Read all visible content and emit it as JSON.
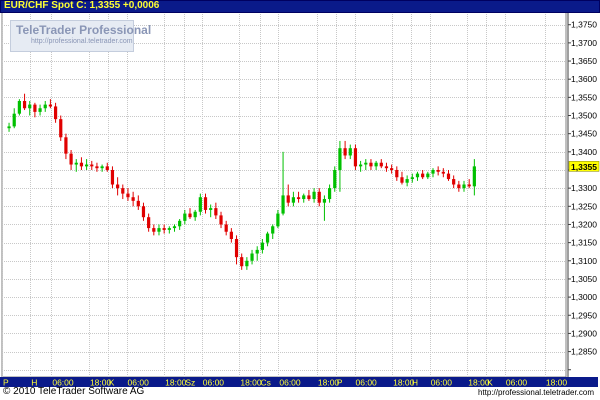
{
  "header": {
    "title": "EUR/CHF Spot C: 1,3355 +0,0006"
  },
  "logo": {
    "name": "TeleTrader Professional",
    "url": "http://professional.teletrader.com"
  },
  "footer": {
    "copyright": "© 2010 TeleTrader Software AG",
    "url": "http://professional.teletrader.com"
  },
  "colors": {
    "up": "#00c000",
    "down": "#e00000",
    "grid": "#c8c8c8",
    "axis_bar": "#0a1a8a",
    "axis_text": "#ffff33",
    "last_price_bg": "#ffff00"
  },
  "chart_data": {
    "type": "candlestick",
    "last_price": "1,3355",
    "ylim": [
      1.278,
      1.3785
    ],
    "y_ticks": [
      1.28,
      1.285,
      1.29,
      1.295,
      1.3,
      1.305,
      1.31,
      1.315,
      1.32,
      1.325,
      1.33,
      1.335,
      1.34,
      1.345,
      1.35,
      1.355,
      1.36,
      1.365,
      1.37,
      1.375
    ],
    "y_tick_labels": [
      "",
      "1,2850",
      "1,2900",
      "1,2950",
      "1,3000",
      "1,3050",
      "1,3100",
      "1,3150",
      "1,3200",
      "1,3250",
      "1,3300",
      "",
      "1,3400",
      "1,3450",
      "1,3500",
      "1,3550",
      "1,3600",
      "1,3650",
      "1,3700",
      "1,3750"
    ],
    "x_range": [
      0,
      120
    ],
    "x_ticks": [
      {
        "x": 0,
        "label": "P"
      },
      {
        "x": 6,
        "label": "H"
      },
      {
        "x": 10.5,
        "label": "06:00"
      },
      {
        "x": 18.5,
        "label": "18:00"
      },
      {
        "x": 22.5,
        "label": "K"
      },
      {
        "x": 26.5,
        "label": "06:00"
      },
      {
        "x": 34.5,
        "label": "18:00"
      },
      {
        "x": 38.8,
        "label": "Sz"
      },
      {
        "x": 42.5,
        "label": "06:00"
      },
      {
        "x": 50.5,
        "label": "18:00"
      },
      {
        "x": 54.8,
        "label": "Cs"
      },
      {
        "x": 58.8,
        "label": "06:00"
      },
      {
        "x": 67,
        "label": "18:00"
      },
      {
        "x": 71,
        "label": "P"
      },
      {
        "x": 75,
        "label": "06:00"
      },
      {
        "x": 83,
        "label": "18:00"
      },
      {
        "x": 87,
        "label": "H"
      },
      {
        "x": 91,
        "label": "06:00"
      },
      {
        "x": 99,
        "label": "18:00"
      },
      {
        "x": 103,
        "label": "K"
      },
      {
        "x": 107,
        "label": "06:00"
      },
      {
        "x": 115.5,
        "label": "18:00"
      }
    ],
    "candles": [
      [
        1.3465,
        1.348,
        1.3455,
        1.347
      ],
      [
        1.347,
        1.352,
        1.3465,
        1.3505
      ],
      [
        1.3505,
        1.3545,
        1.35,
        1.354
      ],
      [
        1.354,
        1.356,
        1.3515,
        1.352
      ],
      [
        1.352,
        1.354,
        1.35,
        1.353
      ],
      [
        1.353,
        1.3535,
        1.3495,
        1.351
      ],
      [
        1.351,
        1.353,
        1.35,
        1.352
      ],
      [
        1.352,
        1.354,
        1.351,
        1.353
      ],
      [
        1.353,
        1.3545,
        1.352,
        1.3525
      ],
      [
        1.3525,
        1.3535,
        1.348,
        1.349
      ],
      [
        1.349,
        1.35,
        1.343,
        1.344
      ],
      [
        1.344,
        1.345,
        1.338,
        1.3395
      ],
      [
        1.3395,
        1.3405,
        1.335,
        1.3365
      ],
      [
        1.3365,
        1.338,
        1.3345,
        1.337
      ],
      [
        1.337,
        1.3385,
        1.335,
        1.336
      ],
      [
        1.336,
        1.338,
        1.335,
        1.3365
      ],
      [
        1.3365,
        1.3375,
        1.335,
        1.336
      ],
      [
        1.336,
        1.337,
        1.3345,
        1.3355
      ],
      [
        1.3355,
        1.3365,
        1.3345,
        1.336
      ],
      [
        1.336,
        1.337,
        1.3345,
        1.335
      ],
      [
        1.335,
        1.336,
        1.33,
        1.331
      ],
      [
        1.331,
        1.333,
        1.328,
        1.33
      ],
      [
        1.33,
        1.331,
        1.327,
        1.3285
      ],
      [
        1.3285,
        1.33,
        1.3265,
        1.3275
      ],
      [
        1.3275,
        1.329,
        1.325,
        1.3265
      ],
      [
        1.3265,
        1.328,
        1.324,
        1.325
      ],
      [
        1.325,
        1.326,
        1.321,
        1.322
      ],
      [
        1.322,
        1.323,
        1.318,
        1.319
      ],
      [
        1.319,
        1.32,
        1.317,
        1.318
      ],
      [
        1.318,
        1.32,
        1.317,
        1.319
      ],
      [
        1.319,
        1.32,
        1.3175,
        1.3185
      ],
      [
        1.3185,
        1.3195,
        1.3175,
        1.319
      ],
      [
        1.319,
        1.32,
        1.318,
        1.3195
      ],
      [
        1.3195,
        1.3215,
        1.3185,
        1.321
      ],
      [
        1.321,
        1.324,
        1.32,
        1.323
      ],
      [
        1.323,
        1.3245,
        1.3215,
        1.322
      ],
      [
        1.322,
        1.324,
        1.321,
        1.3235
      ],
      [
        1.3235,
        1.3285,
        1.3225,
        1.3275
      ],
      [
        1.3275,
        1.3285,
        1.323,
        1.324
      ],
      [
        1.324,
        1.3255,
        1.322,
        1.3245
      ],
      [
        1.3245,
        1.326,
        1.3215,
        1.3225
      ],
      [
        1.3225,
        1.3235,
        1.319,
        1.32
      ],
      [
        1.32,
        1.321,
        1.317,
        1.318
      ],
      [
        1.318,
        1.319,
        1.315,
        1.316
      ],
      [
        1.316,
        1.317,
        1.309,
        1.311
      ],
      [
        1.311,
        1.312,
        1.3075,
        1.3085
      ],
      [
        1.3085,
        1.311,
        1.3075,
        1.31
      ],
      [
        1.31,
        1.313,
        1.309,
        1.312
      ],
      [
        1.312,
        1.314,
        1.31,
        1.313
      ],
      [
        1.313,
        1.316,
        1.312,
        1.315
      ],
      [
        1.315,
        1.318,
        1.314,
        1.3175
      ],
      [
        1.3175,
        1.32,
        1.316,
        1.3195
      ],
      [
        1.3195,
        1.324,
        1.319,
        1.323
      ],
      [
        1.323,
        1.34,
        1.3225,
        1.328
      ],
      [
        1.328,
        1.331,
        1.325,
        1.326
      ],
      [
        1.326,
        1.329,
        1.325,
        1.3275
      ],
      [
        1.3275,
        1.329,
        1.326,
        1.327
      ],
      [
        1.327,
        1.3285,
        1.326,
        1.328
      ],
      [
        1.328,
        1.3295,
        1.3265,
        1.327
      ],
      [
        1.327,
        1.33,
        1.326,
        1.329
      ],
      [
        1.329,
        1.33,
        1.325,
        1.326
      ],
      [
        1.326,
        1.328,
        1.321,
        1.327
      ],
      [
        1.327,
        1.331,
        1.326,
        1.33
      ],
      [
        1.33,
        1.336,
        1.329,
        1.335
      ],
      [
        1.335,
        1.343,
        1.329,
        1.341
      ],
      [
        1.341,
        1.343,
        1.338,
        1.339
      ],
      [
        1.339,
        1.342,
        1.338,
        1.341
      ],
      [
        1.341,
        1.342,
        1.335,
        1.336
      ],
      [
        1.336,
        1.3375,
        1.3345,
        1.3365
      ],
      [
        1.3365,
        1.338,
        1.335,
        1.337
      ],
      [
        1.337,
        1.338,
        1.335,
        1.336
      ],
      [
        1.336,
        1.3375,
        1.335,
        1.337
      ],
      [
        1.337,
        1.338,
        1.3355,
        1.336
      ],
      [
        1.336,
        1.337,
        1.3345,
        1.3355
      ],
      [
        1.3355,
        1.3365,
        1.334,
        1.335
      ],
      [
        1.335,
        1.336,
        1.332,
        1.333
      ],
      [
        1.333,
        1.3345,
        1.331,
        1.3315
      ],
      [
        1.3315,
        1.3335,
        1.3305,
        1.3325
      ],
      [
        1.3325,
        1.334,
        1.3315,
        1.333
      ],
      [
        1.333,
        1.3345,
        1.332,
        1.334
      ],
      [
        1.334,
        1.335,
        1.3325,
        1.333
      ],
      [
        1.333,
        1.3345,
        1.3325,
        1.334
      ],
      [
        1.334,
        1.3355,
        1.333,
        1.335
      ],
      [
        1.335,
        1.336,
        1.3335,
        1.3345
      ],
      [
        1.3345,
        1.3355,
        1.333,
        1.334
      ],
      [
        1.334,
        1.335,
        1.332,
        1.3325
      ],
      [
        1.3325,
        1.3335,
        1.33,
        1.331
      ],
      [
        1.331,
        1.332,
        1.329,
        1.33
      ],
      [
        1.33,
        1.332,
        1.329,
        1.331
      ],
      [
        1.331,
        1.3325,
        1.33,
        1.3305
      ],
      [
        1.3305,
        1.338,
        1.328,
        1.336
      ]
    ]
  }
}
